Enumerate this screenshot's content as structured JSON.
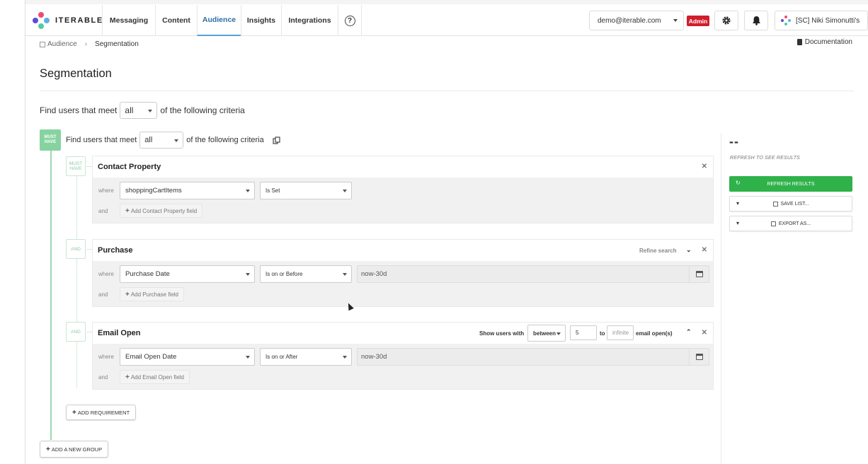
{
  "nav": {
    "logo_text": "ITERABLE",
    "items": [
      "Messaging",
      "Content",
      "Audience",
      "Insights",
      "Integrations"
    ],
    "active_item": "Audience",
    "help_glyph": "?",
    "account_email": "demo@iterable.com",
    "admin_badge": "Admin",
    "user_label": "[SC] Niki Simonutti's",
    "icons": [
      "gear-icon",
      "bell-icon",
      "help-icon"
    ]
  },
  "breadcrumb": {
    "parent": "Audience",
    "separator": "›",
    "current": "Segmentation"
  },
  "documentation_link": "Documentation",
  "page_title": "Segmentation",
  "outer_criteria": {
    "prefix": "Find users that meet",
    "match": "all",
    "suffix": "of the following criteria"
  },
  "group": {
    "badge": "MUST HAVE",
    "prefix": "Find users that meet",
    "match": "all",
    "suffix": "of the following criteria",
    "cards": [
      {
        "connector": "MUST HAVE",
        "title": "Contact Property",
        "where_label": "where",
        "field": "shoppingCartItems",
        "operator": "Is Set",
        "and_label": "and",
        "add_label": "Add Contact Property field"
      },
      {
        "connector": "AND",
        "title": "Purchase",
        "refine_label": "Refine search",
        "where_label": "where",
        "field": "Purchase Date",
        "operator": "Is on or Before",
        "value": "now-30d",
        "and_label": "and",
        "add_label": "Add Purchase field"
      },
      {
        "connector": "AND",
        "title": "Email Open",
        "show_users_label": "Show users with",
        "range_operator": "between",
        "range_from": "5",
        "range_to_label": "to",
        "range_to_placeholder": "infinite",
        "range_unit": "email open(s)",
        "where_label": "where",
        "field": "Email Open Date",
        "operator": "Is on or After",
        "value": "now-30d",
        "and_label": "and",
        "add_label": "Add Email Open field"
      }
    ],
    "add_requirement": "ADD REQUIREMENT"
  },
  "add_group": "ADD A NEW GROUP",
  "right_panel": {
    "count": "--",
    "note": "REFRESH TO SEE RESULTS",
    "refresh": "REFRESH RESULTS",
    "save": "SAVE LIST...",
    "export": "EXPORT AS..."
  },
  "colors": {
    "accent_blue": "#2d6da3",
    "admin_red": "#d01e2c",
    "refresh_green": "#2fb24a",
    "must_have_green": "#86d3a0"
  }
}
